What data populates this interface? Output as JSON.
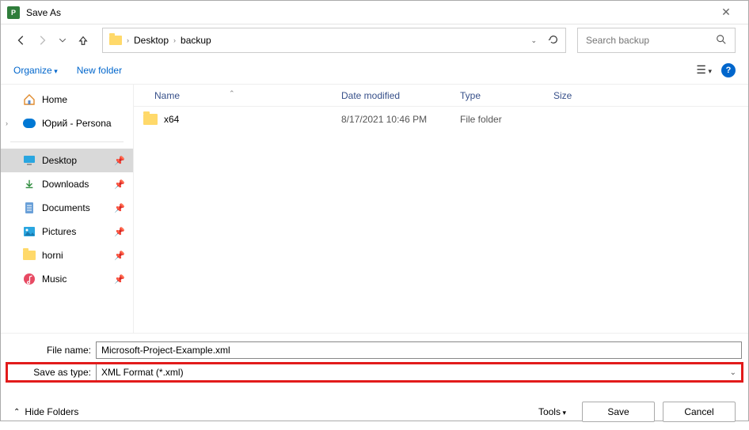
{
  "window": {
    "title": "Save As",
    "app_abbrev": "P"
  },
  "breadcrumb": {
    "parts": [
      "Desktop",
      "backup"
    ]
  },
  "search": {
    "placeholder": "Search backup"
  },
  "toolbar": {
    "organize": "Organize",
    "new_folder": "New folder"
  },
  "sidebar": {
    "items": [
      {
        "label": "Home",
        "icon": "home"
      },
      {
        "label": "Юрий - Persona",
        "icon": "cloud",
        "expandable": true
      }
    ],
    "quick": [
      {
        "label": "Desktop",
        "icon": "monitor",
        "selected": true
      },
      {
        "label": "Downloads",
        "icon": "download"
      },
      {
        "label": "Documents",
        "icon": "doc"
      },
      {
        "label": "Pictures",
        "icon": "pic"
      },
      {
        "label": "horni",
        "icon": "folder"
      },
      {
        "label": "Music",
        "icon": "music"
      }
    ]
  },
  "columns": {
    "name": "Name",
    "date": "Date modified",
    "type": "Type",
    "size": "Size"
  },
  "rows": [
    {
      "name": "x64",
      "date": "8/17/2021 10:46 PM",
      "type": "File folder",
      "size": ""
    }
  ],
  "fields": {
    "filename_label": "File name:",
    "filename_value": "Microsoft-Project-Example.xml",
    "saveastype_label": "Save as type:",
    "saveastype_value": "XML Format (*.xml)"
  },
  "footer": {
    "hide_folders": "Hide Folders",
    "tools": "Tools",
    "save": "Save",
    "cancel": "Cancel"
  }
}
